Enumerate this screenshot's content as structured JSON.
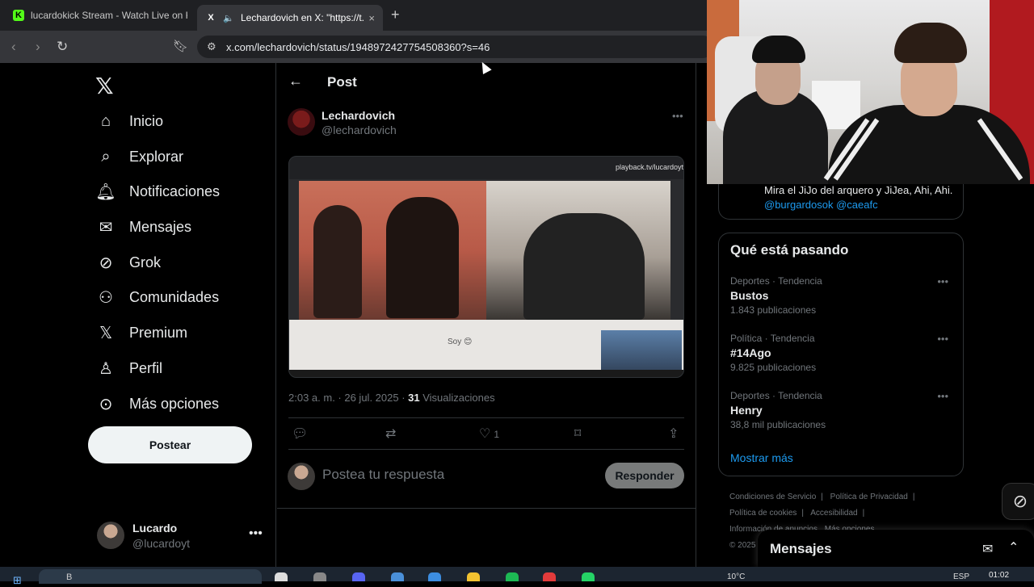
{
  "browser": {
    "tabs": [
      {
        "title": "lucardokick Stream - Watch Live on K",
        "favicon": "K",
        "favicon_color": "#53fc18"
      },
      {
        "title": "Lechardovich en X: \"https://t.c",
        "favicon": "X",
        "favicon_color": "#ffffff"
      }
    ],
    "new_tab_icon": "+",
    "close_icon": "×",
    "url": "x.com/lechardovich/status/1948972427754508360?s=46"
  },
  "leftnav": {
    "items": [
      {
        "label": "Inicio",
        "icon": "home-icon"
      },
      {
        "label": "Explorar",
        "icon": "search-icon"
      },
      {
        "label": "Notificaciones",
        "icon": "bell-icon"
      },
      {
        "label": "Mensajes",
        "icon": "mail-icon"
      },
      {
        "label": "Grok",
        "icon": "grok-icon"
      },
      {
        "label": "Comunidades",
        "icon": "people-icon"
      },
      {
        "label": "Premium",
        "icon": "x-icon"
      },
      {
        "label": "Perfil",
        "icon": "person-icon"
      },
      {
        "label": "Más opciones",
        "icon": "more-icon"
      }
    ],
    "post_button": "Postear",
    "user": {
      "name": "Lucardo",
      "handle": "@lucardoyt"
    }
  },
  "post": {
    "header": "Post",
    "author_name": "Lechardovich",
    "author_handle": "@lechardovich",
    "media_badge": "playback.tv/lucardoyt",
    "media_soy": "Soy 😊",
    "time": "2:03 a. m. · 26 jul. 2025 · ",
    "views_count": "31",
    "views_label": " Visualizaciones",
    "like_count": "1",
    "reply_placeholder": "Postea tu respuesta",
    "reply_button": "Responder"
  },
  "right": {
    "prev_card_text": "Mira el JiJo del arquero y JiJea, Ahi, Ahi.",
    "prev_card_links": "@burgardosok @caeafc",
    "trends_title": "Qué está pasando",
    "trends": [
      {
        "category": "Deportes · Tendencia",
        "title": "Bustos",
        "count": "1.843 publicaciones"
      },
      {
        "category": "Política · Tendencia",
        "title": "#14Ago",
        "count": "9.825 publicaciones"
      },
      {
        "category": "Deportes · Tendencia",
        "title": "Henry",
        "count": "38,8 mil publicaciones"
      }
    ],
    "show_more": "Mostrar más",
    "footer": [
      "Condiciones de Servicio",
      "Política de Privacidad",
      "Política de cookies",
      "Accesibilidad",
      "Información de anuncios",
      "Más opciones",
      "© 2025"
    ],
    "messages_title": "Mensajes"
  },
  "taskbar": {
    "search_placeholder": "B",
    "weather": "10°C",
    "time": "01:02",
    "lang": "ESP"
  }
}
